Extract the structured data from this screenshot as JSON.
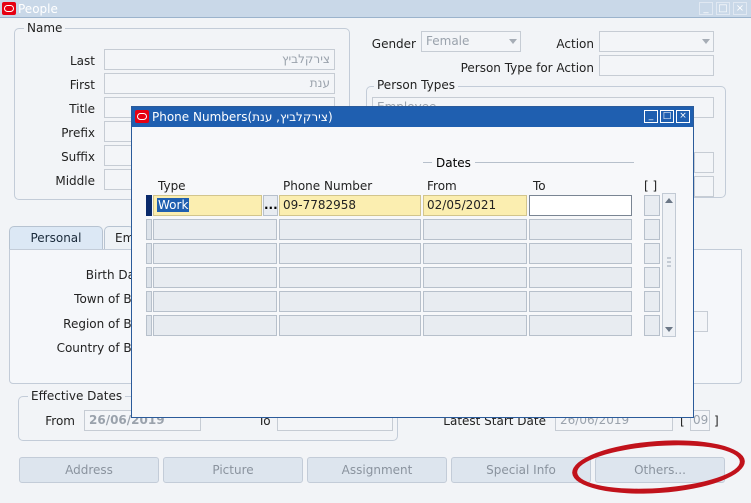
{
  "window": {
    "title": "People"
  },
  "name_group": {
    "title": "Name",
    "last_label": "Last",
    "last_value": "צירקלביץ",
    "first_label": "First",
    "first_value": "ענת",
    "title_label": "Title",
    "prefix_label": "Prefix",
    "suffix_label": "Suffix",
    "middle_label": "Middle"
  },
  "gender": {
    "label": "Gender",
    "value": "Female"
  },
  "action": {
    "label": "Action",
    "value": ""
  },
  "person_type_for_action": {
    "label": "Person Type for Action"
  },
  "person_types": {
    "title": "Person Types",
    "value": "Employee"
  },
  "tabs": {
    "personal": "Personal",
    "employment": "Em"
  },
  "personal_fields": {
    "birth_date": "Birth Da",
    "town_of_birth": "Town of Bi",
    "region_of_birth": "Region of Bi",
    "country_of_birth": "Country of Bi"
  },
  "effective_dates": {
    "title": "Effective Dates",
    "from_label": "From",
    "from_value": "26/06/2019",
    "to_label": "To",
    "to_value": ""
  },
  "latest_start": {
    "label": "Latest Start Date",
    "value": "26/06/2019",
    "extra": "09",
    "bracket_open": "[",
    "bracket_close": "]"
  },
  "buttons": {
    "address": "Address",
    "picture": "Picture",
    "assignment": "Assignment",
    "special_info": "Special Info",
    "others": "Others..."
  },
  "phone_modal": {
    "title": "Phone Numbers(צירקלביץ, ענת)",
    "dates_header": "Dates",
    "columns": {
      "type": "Type",
      "phone_number": "Phone Number",
      "from": "From",
      "to": "To",
      "flex": "[ ]"
    },
    "rows": [
      {
        "type": "Work",
        "phone_number": "09-7782958",
        "from": "02/05/2021",
        "to": ""
      },
      {
        "type": "",
        "phone_number": "",
        "from": "",
        "to": ""
      },
      {
        "type": "",
        "phone_number": "",
        "from": "",
        "to": ""
      },
      {
        "type": "",
        "phone_number": "",
        "from": "",
        "to": ""
      },
      {
        "type": "",
        "phone_number": "",
        "from": "",
        "to": ""
      },
      {
        "type": "",
        "phone_number": "",
        "from": "",
        "to": ""
      }
    ],
    "lov_button": "..."
  },
  "colors": {
    "title_bar": "#1f5fb0",
    "highlight": "#fbeeb0",
    "annotation": "#c1121b"
  }
}
